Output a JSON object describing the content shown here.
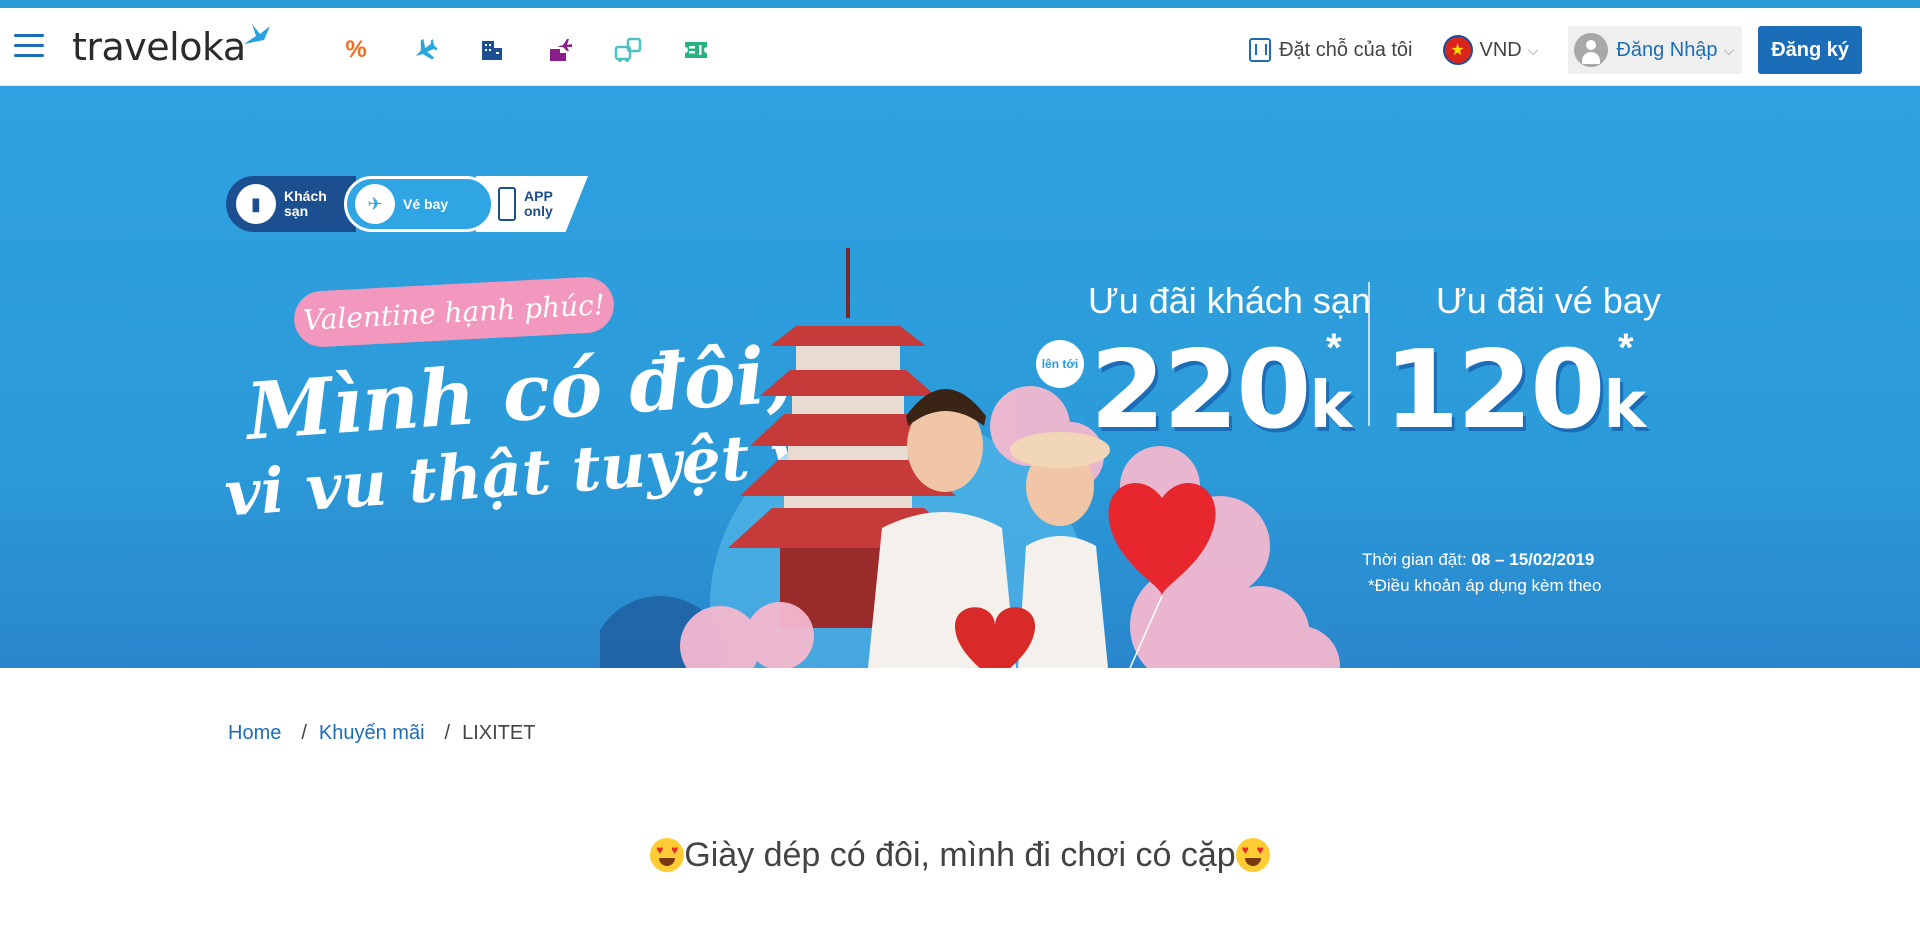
{
  "header": {
    "logo_text": "traveloka",
    "nav_icons": [
      {
        "name": "promo-icon",
        "glyph": "%",
        "color": "#f26c22"
      },
      {
        "name": "flight-icon",
        "glyph": "✈",
        "color": "#2aa8dd"
      },
      {
        "name": "hotel-icon",
        "glyph": "▮",
        "color": "#1b4f8f"
      },
      {
        "name": "flight-hotel-icon",
        "glyph": "✈",
        "color": "#8a1c8c"
      },
      {
        "name": "bus-icon",
        "glyph": "⛟",
        "color": "#4cc2c4"
      },
      {
        "name": "ticket-icon",
        "glyph": "▣",
        "color": "#26b37c"
      }
    ],
    "my_booking": "Đặt chỗ của tôi",
    "currency": "VND",
    "login": "Đăng Nhập",
    "register": "Đăng ký"
  },
  "banner": {
    "pill": {
      "hotel": "Khách\nsạn",
      "flight": "Vé bay",
      "app": "APP\nonly"
    },
    "tagline": "Valentine hạnh phúc!",
    "headline_1": "Mình có đôi,",
    "headline_2": "vi vu thật tuyệt vời!",
    "hotel_offer_label": "Ưu đãi khách sạn",
    "flight_offer_label": "Ưu đãi vé bay",
    "upto": "lên tới",
    "hotel_amount": "220",
    "flight_amount": "120",
    "unit": "k",
    "asterisk": "*",
    "period_label": "Thời gian đặt:",
    "period_value": "08 – 15/02/2019",
    "terms": "*Điều khoản áp dụng kèm theo"
  },
  "breadcrumb": {
    "home": "Home",
    "promo": "Khuyến mãi",
    "current": "LIXITET",
    "separator": "/"
  },
  "article": {
    "title": "Giày dép có đôi, mình đi chơi có cặp"
  },
  "colors": {
    "accent": "#1b6db7",
    "banner_blue": "#2b9ad9",
    "topstripe": "#2b9bd8"
  }
}
